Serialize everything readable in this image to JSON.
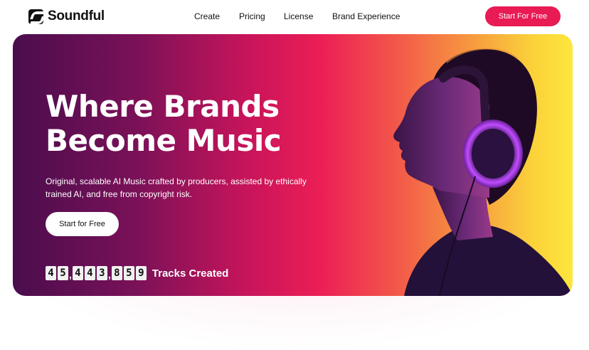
{
  "brand": {
    "name": "Soundful"
  },
  "nav": {
    "items": [
      "Create",
      "Pricing",
      "License",
      "Brand Experience"
    ]
  },
  "header": {
    "cta_label": "Start For Free"
  },
  "hero": {
    "title_line1": "Where Brands",
    "title_line2": "Become Music",
    "subtitle": "Original, scalable AI Music crafted by producers, assisted by ethically trained AI, and free from copyright risk.",
    "cta_label": "Start for Free",
    "counter": {
      "digits": [
        "4",
        "5",
        "4",
        "4",
        "3",
        "8",
        "5",
        "9"
      ],
      "groups": [
        2,
        3,
        3
      ],
      "label": "Tracks Created"
    }
  },
  "colors": {
    "accent": "#e81b54",
    "gradient_start": "#4a0d4d",
    "gradient_end": "#fde63d"
  },
  "icons": {
    "logo": "soundful-logo-icon",
    "portrait": "woman-with-headphones-image"
  }
}
